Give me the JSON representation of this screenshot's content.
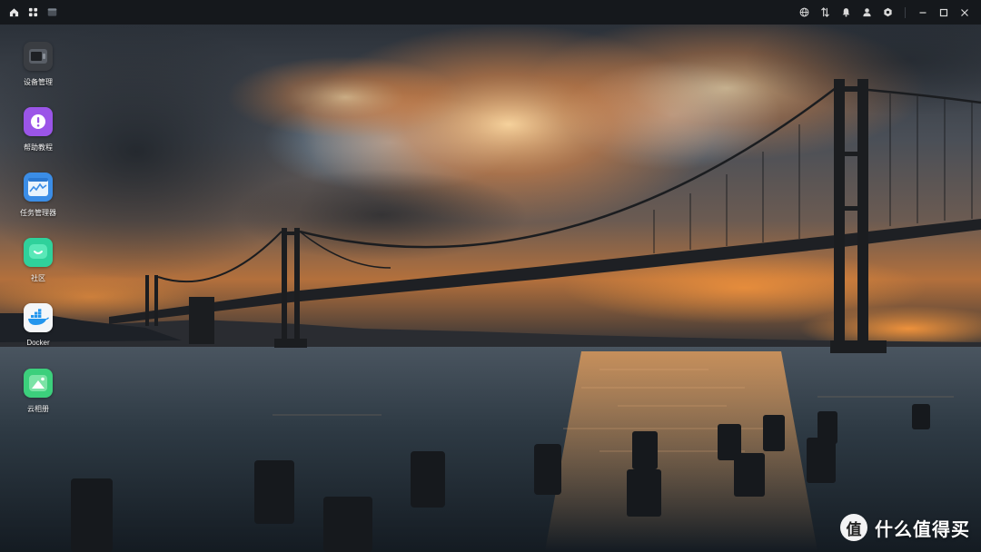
{
  "topbar": {
    "left_icons": [
      "home-icon",
      "apps-grid-icon",
      "file-manager-icon"
    ],
    "right_icons": [
      "globe-icon",
      "transfer-icon",
      "bell-icon",
      "user-icon",
      "settings-icon"
    ],
    "window_controls": [
      "minimize-icon",
      "maximize-icon",
      "close-icon"
    ]
  },
  "desktop": {
    "items": [
      {
        "label": "设备管理",
        "icon": "device-manager-icon",
        "color": "#3a3d42"
      },
      {
        "label": "帮助教程",
        "icon": "help-icon",
        "color": "#9b55e8"
      },
      {
        "label": "任务管理器",
        "icon": "task-manager-icon",
        "color": "#3b8de6"
      },
      {
        "label": "社区",
        "icon": "community-icon",
        "color": "#2fd19b"
      },
      {
        "label": "Docker",
        "icon": "docker-icon",
        "color": "#f4f6f8"
      },
      {
        "label": "云相册",
        "icon": "photo-album-icon",
        "color": "#3ccf7c"
      }
    ]
  },
  "watermark": {
    "glyph": "值",
    "text": "什么值得买"
  }
}
